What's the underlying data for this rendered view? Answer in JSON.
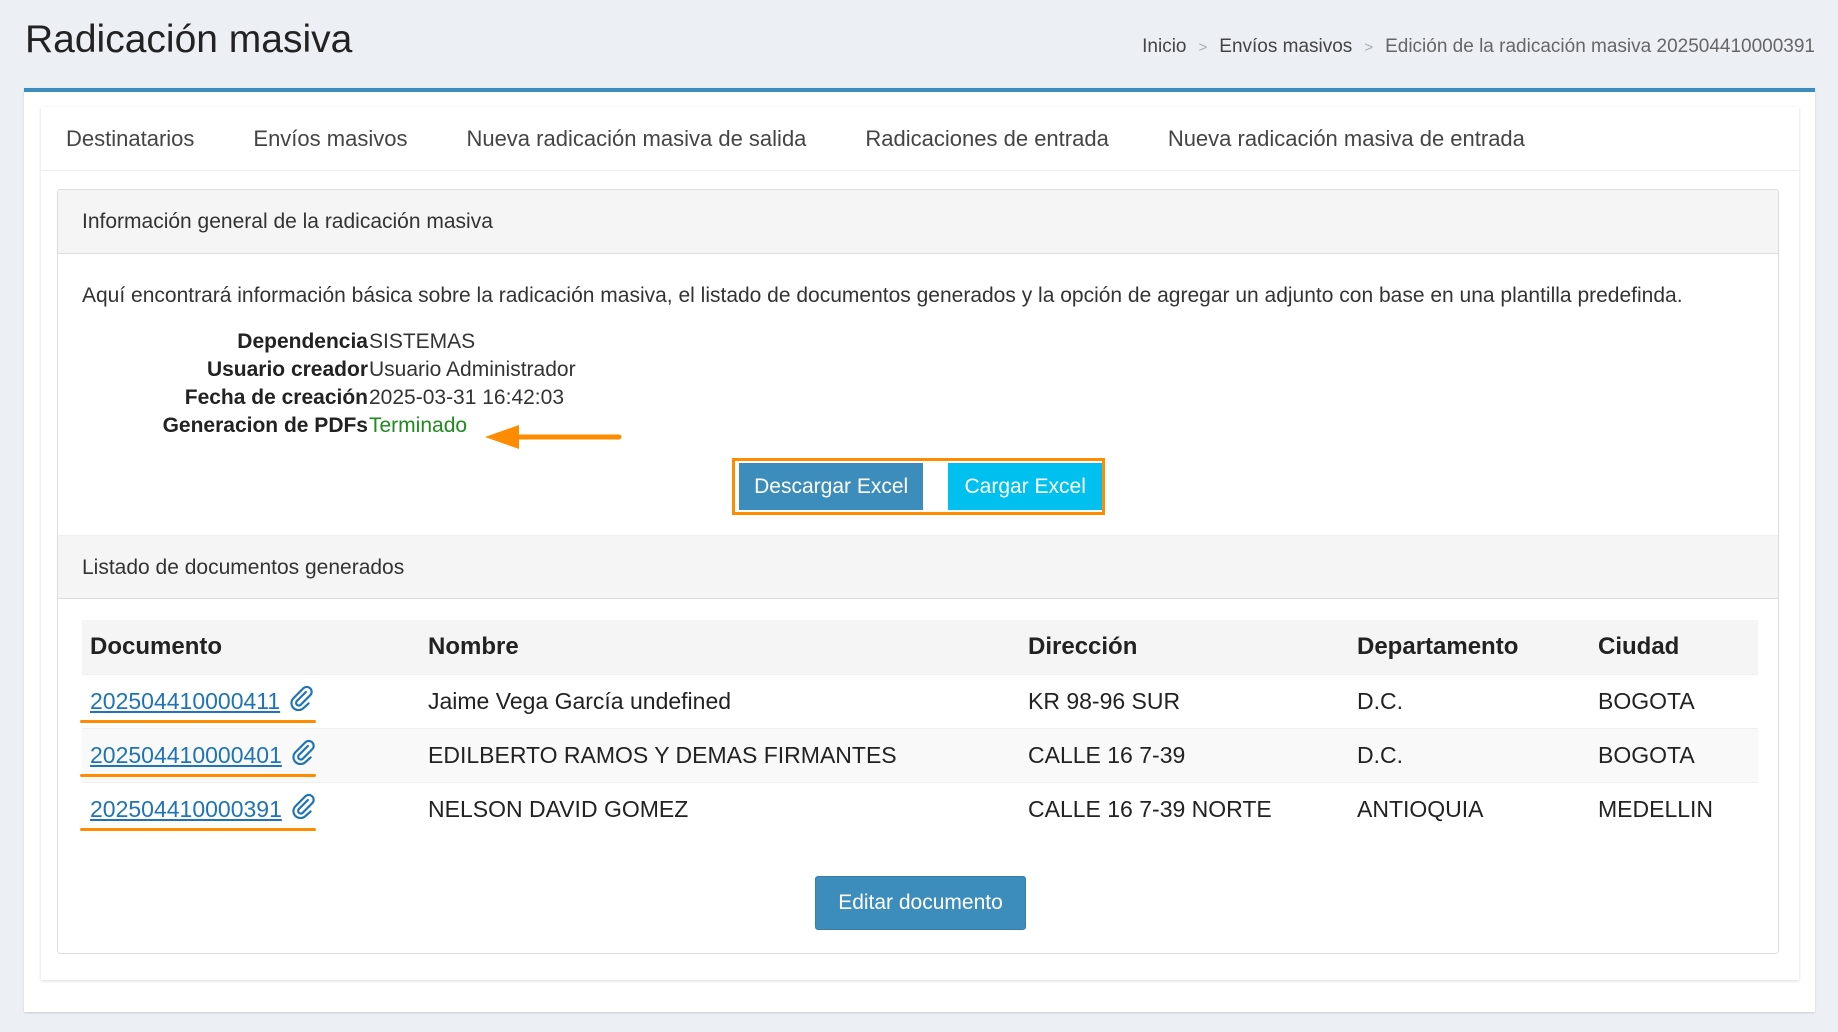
{
  "header": {
    "title": "Radicación masiva",
    "breadcrumb": [
      "Inicio",
      "Envíos masivos",
      "Edición de la radicación masiva 202504410000391"
    ]
  },
  "tabs": [
    "Destinatarios",
    "Envíos masivos",
    "Nueva radicación masiva de salida",
    "Radicaciones de entrada",
    "Nueva radicación masiva de entrada"
  ],
  "general": {
    "heading": "Información general de la radicación masiva",
    "intro": "Aquí encontrará información básica sobre la radicación masiva, el listado de documentos generados y la opción de agregar un adjunto con base en una plantilla predefinda.",
    "fields": [
      {
        "label": "Dependencia",
        "value": "SISTEMAS"
      },
      {
        "label": "Usuario creador",
        "value": "Usuario Administrador"
      },
      {
        "label": "Fecha de creación",
        "value": "2025-03-31 16:42:03"
      },
      {
        "label": "Generacion de PDFs",
        "value": "Terminado"
      }
    ],
    "download_label": "Descargar Excel",
    "upload_label": "Cargar Excel"
  },
  "documents": {
    "heading": "Listado de documentos generados",
    "columns": [
      "Documento",
      "Nombre",
      "Dirección",
      "Departamento",
      "Ciudad"
    ],
    "rows": [
      {
        "doc": "202504410000411",
        "name": "Jaime Vega García undefined",
        "dir": "KR 98-96 SUR",
        "dep": "D.C.",
        "city": "BOGOTA"
      },
      {
        "doc": "202504410000401",
        "name": "EDILBERTO RAMOS Y DEMAS FIRMANTES",
        "dir": "CALLE 16 7-39",
        "dep": "D.C.",
        "city": "BOGOTA"
      },
      {
        "doc": "202504410000391",
        "name": "NELSON DAVID GOMEZ",
        "dir": "CALLE 16 7-39 NORTE",
        "dep": "ANTIOQUIA",
        "city": "MEDELLIN"
      }
    ],
    "edit_label": "Editar documento"
  },
  "colors": {
    "primary": "#3c8dbc",
    "info": "#00c0ef",
    "annotation": "#ff8c00",
    "success": "#1e8a1e"
  },
  "icons": [
    "paperclip-icon",
    "arrow-left-icon"
  ]
}
